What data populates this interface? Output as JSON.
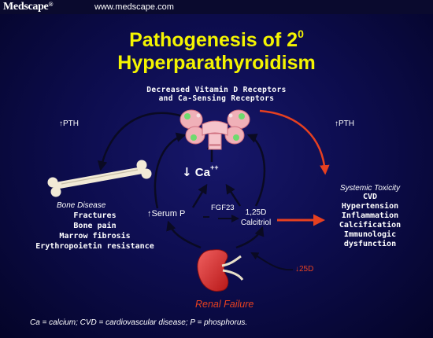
{
  "header": {
    "logo": "Medscape",
    "logo_mark": "®",
    "url": "www.medscape.com"
  },
  "title": {
    "line1": "Pathogenesis of 2",
    "line1_superscript": "0",
    "line2": "Hyperparathyroidism"
  },
  "diagram": {
    "subtitle": [
      "Decreased Vitamin D Receptors",
      "and Ca-Sensing Receptors"
    ],
    "pth_left": "↑PTH",
    "pth_right": "↑PTH",
    "calcium": {
      "arrow": "↓",
      "text": "Ca",
      "superscript": "++"
    },
    "bone_disease": {
      "title": "Bone Disease",
      "items": [
        "Fractures",
        "Bone pain",
        "Marrow fibrosis",
        "Erythropoietin resistance"
      ]
    },
    "serum_p": "↑Serum P",
    "fgf23": "FGF23",
    "calcitriol": [
      "1,25D",
      "Calcitriol"
    ],
    "systemic_toxicity": {
      "title": "Systemic Toxicity",
      "items": [
        "CVD",
        "Hypertension",
        "Inflammation",
        "Calcification",
        "Immunologic",
        "dysfunction"
      ]
    },
    "d25": "↓25D",
    "renal_failure": "Renal Failure"
  },
  "footnote": "Ca = calcium; CVD = cardiovascular disease; P = phosphorus.",
  "colors": {
    "background": "#0d0d4f",
    "title": "#f4f400",
    "text": "#ffffff",
    "accent_red": "#e64020",
    "arrow_dark": "#0a0a22",
    "gland_pink": "#f0b0b8",
    "gland_spot": "#6edb6e",
    "kidney": "#d83030",
    "bone": "#f2ead6"
  },
  "icons": [
    "parathyroid-gland-icon",
    "bone-icon",
    "kidney-icon"
  ]
}
